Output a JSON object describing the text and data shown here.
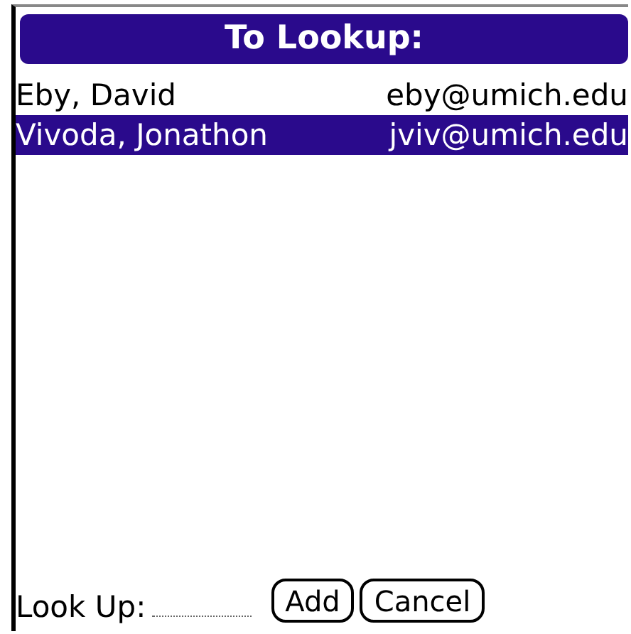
{
  "title": "To Lookup:",
  "contacts": [
    {
      "name": "Eby, David",
      "email": "eby@umich.edu",
      "selected": false
    },
    {
      "name": "Vivoda, Jonathon",
      "email": "jviv@umich.edu",
      "selected": true
    }
  ],
  "lookup": {
    "label": "Look Up:"
  },
  "buttons": [
    "Add",
    "Cancel"
  ]
}
